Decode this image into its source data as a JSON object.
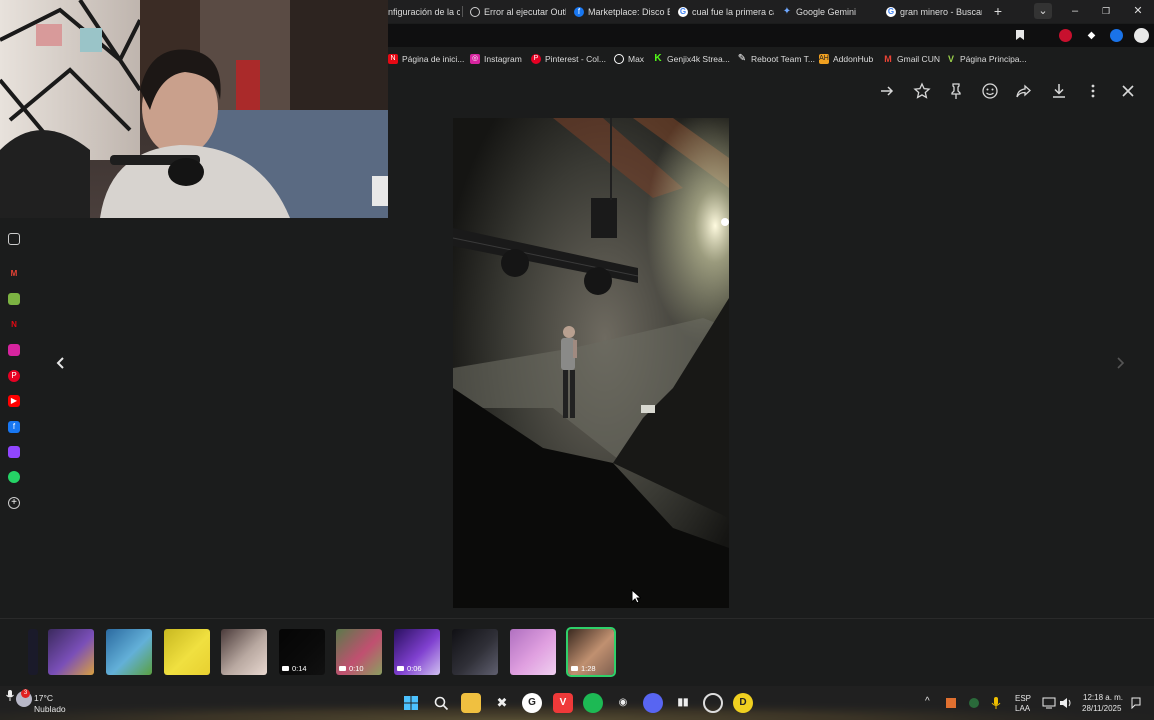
{
  "tabs": [
    {
      "label": "nfiguración de la c",
      "icon": "settings-icon",
      "color": "#8ab4f8"
    },
    {
      "label": "Error al ejecutar Outl",
      "icon": "openai-icon",
      "color": "#cfcfcf"
    },
    {
      "label": "Marketplace: Disco E",
      "icon": "facebook-icon",
      "color": "#1877f2",
      "badge": "1"
    },
    {
      "label": "cual fue la primera ca",
      "icon": "google-icon",
      "color": "#ffffff"
    },
    {
      "label": "Google Gemini",
      "icon": "gemini-icon",
      "color": "#6fa8ff"
    },
    {
      "label": "gran minero - Buscar",
      "icon": "google-icon",
      "color": "#ffffff"
    }
  ],
  "new_tab": "+",
  "window_controls": {
    "tab_search": "⌄",
    "minimize": "–",
    "restore": "❐",
    "close": "✕"
  },
  "bookmarks": [
    {
      "label": "Página de inici...",
      "icon": "netflix-icon",
      "color": "#e50914"
    },
    {
      "label": "Instagram",
      "icon": "instagram-icon",
      "color": "#d6249f"
    },
    {
      "label": "Pinterest - Col...",
      "icon": "pinterest-icon",
      "color": "#e60023"
    },
    {
      "label": "Max",
      "icon": "max-icon",
      "color": "#ffffff"
    },
    {
      "label": "Genjix4k Strea...",
      "icon": "kick-icon",
      "color": "#53fc18"
    },
    {
      "label": "Reboot Team T...",
      "icon": "reboot-icon",
      "color": "#ffffff"
    },
    {
      "label": "AddonHub",
      "icon": "addonhub-icon",
      "color": "#f0a020",
      "icon_text": "AH"
    },
    {
      "label": "Gmail CUN",
      "icon": "gmail-icon",
      "color": "#ea4335"
    },
    {
      "label": "Página Principa...",
      "icon": "vip-icon",
      "color": "#9bd14b"
    }
  ],
  "viewer_actions": [
    "forward-icon",
    "star-icon",
    "pin-icon",
    "emoji-icon",
    "share-icon",
    "download-icon",
    "more-icon",
    "close-icon"
  ],
  "thumbnails": [
    {
      "duration": "",
      "colors": [
        "#3b2a5e",
        "#7a4fb8",
        "#d8a040"
      ]
    },
    {
      "duration": "",
      "colors": [
        "#2b6aa0",
        "#63b0d8",
        "#5aa040"
      ]
    },
    {
      "duration": "",
      "colors": [
        "#c8b820",
        "#f0e040",
        "#e8d030"
      ]
    },
    {
      "duration": "",
      "colors": [
        "#4a3a3a",
        "#b8a8a0",
        "#e8d8d0"
      ]
    },
    {
      "duration": "0:14",
      "colors": [
        "#050505",
        "#0a0a0a",
        "#111111"
      ]
    },
    {
      "duration": "0:10",
      "colors": [
        "#5a7a4a",
        "#c05070",
        "#8aa060"
      ]
    },
    {
      "duration": "0:06",
      "colors": [
        "#2a1060",
        "#8040d0",
        "#d0c0f0"
      ]
    },
    {
      "duration": "",
      "colors": [
        "#101014",
        "#303038",
        "#606070"
      ]
    },
    {
      "duration": "",
      "colors": [
        "#b070c0",
        "#e0a0e0",
        "#f0d0f0"
      ]
    },
    {
      "duration": "1:28",
      "colors": [
        "#3a2a20",
        "#c09070",
        "#806050"
      ]
    }
  ],
  "weather": {
    "temp": "17°C",
    "condition": "Nublado"
  },
  "tray": {
    "lang1": "ESP",
    "lang2": "LAA",
    "time": "12:18 a. m.",
    "date": "28/11/2025"
  }
}
